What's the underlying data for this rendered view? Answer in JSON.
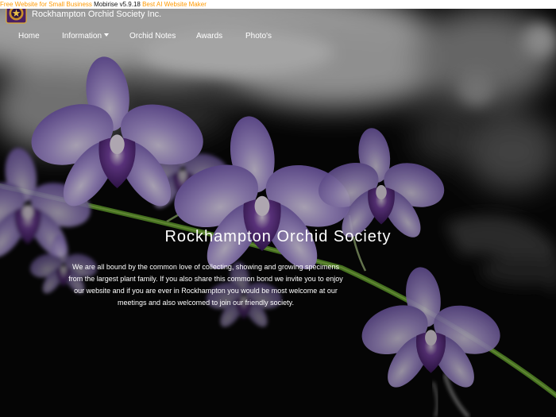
{
  "banner": {
    "part1": "Free Website for Small Business",
    "part2": "Mobirise v5.9.18",
    "part3": "Best AI Website Maker"
  },
  "brand": {
    "name": "Rockhampton Orchid Society Inc.",
    "logo_icon": "society-badge-icon"
  },
  "nav": {
    "home": "Home",
    "information": "Information",
    "orchid_notes": "Orchid Notes",
    "awards": "Awards",
    "photos": "Photo's"
  },
  "hero": {
    "title": "Rockhampton Orchid Society",
    "text": "We are all bound by the common love of collecting, showing and growing specimens from the largest plant family. If you also share this common bond we invite you to enjoy our website and if you are ever in Rockhampton you would be most welcome at our meetings and also welcomed to join our friendly society."
  },
  "colors": {
    "banner_link": "#ff9900",
    "text": "#ffffff",
    "petal": "#9a82d0",
    "lip": "#4a2370"
  }
}
